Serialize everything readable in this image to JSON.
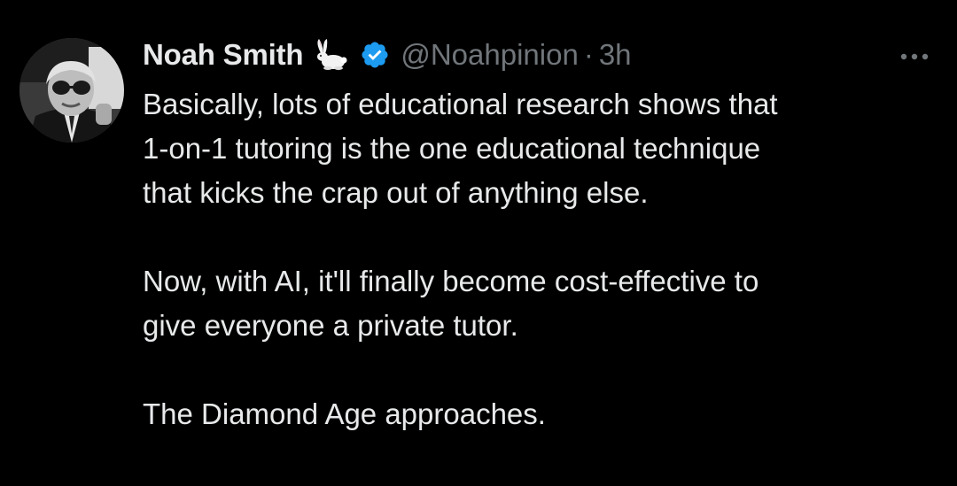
{
  "tweet": {
    "author": {
      "display_name": "Noah Smith",
      "name_emoji": "rabbit-icon",
      "verified_badge": "verified-icon",
      "handle": "@Noahpinion",
      "separator": "·",
      "time": "3h"
    },
    "more_menu_icon": "more-horizontal-icon",
    "paragraphs": [
      "Basically, lots of educational research shows that\n1-on-1 tutoring is the one educational technique\nthat kicks the crap out of anything else.",
      "Now, with AI, it'll finally become cost-effective to\ngive everyone a private tutor.",
      "The Diamond Age approaches."
    ]
  },
  "colors": {
    "background": "#000000",
    "primary_text": "#e7e9ea",
    "secondary_text": "#71767b",
    "verified_blue": "#1d9bf0"
  }
}
